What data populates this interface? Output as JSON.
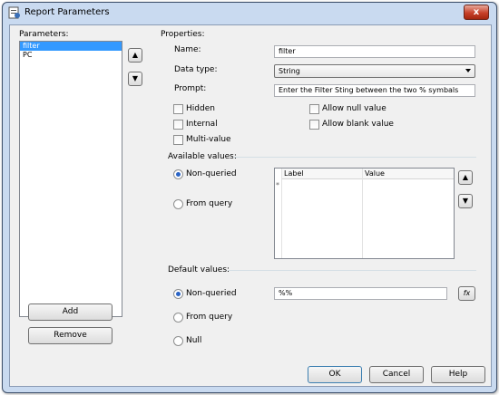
{
  "window": {
    "title": "Report Parameters",
    "close_label": "x"
  },
  "parameters": {
    "label": "Parameters:",
    "items": [
      "filter",
      "PC"
    ],
    "selected_index": 0,
    "move_up": "▲",
    "move_down": "▼",
    "add_label": "Add",
    "remove_label": "Remove"
  },
  "properties": {
    "heading": "Properties:",
    "name_label": "Name:",
    "name_value": "filter",
    "datatype_label": "Data type:",
    "datatype_value": "String",
    "prompt_label": "Prompt:",
    "prompt_value": "Enter the Filter Sting between the two % symbals",
    "checkboxes": {
      "hidden": "Hidden",
      "internal": "Internal",
      "multi_value": "Multi-value",
      "allow_null": "Allow null value",
      "allow_blank": "Allow blank value"
    }
  },
  "available_values": {
    "heading": "Available values:",
    "non_queried": "Non-queried",
    "from_query": "From query",
    "columns": [
      "Label",
      "Value"
    ],
    "new_row_marker": "*",
    "up": "▲",
    "down": "▼"
  },
  "default_values": {
    "heading": "Default values:",
    "non_queried": "Non-queried",
    "from_query": "From query",
    "null": "Null",
    "value": "%%",
    "fx": "fx"
  },
  "footer": {
    "ok": "OK",
    "cancel": "Cancel",
    "help": "Help"
  }
}
